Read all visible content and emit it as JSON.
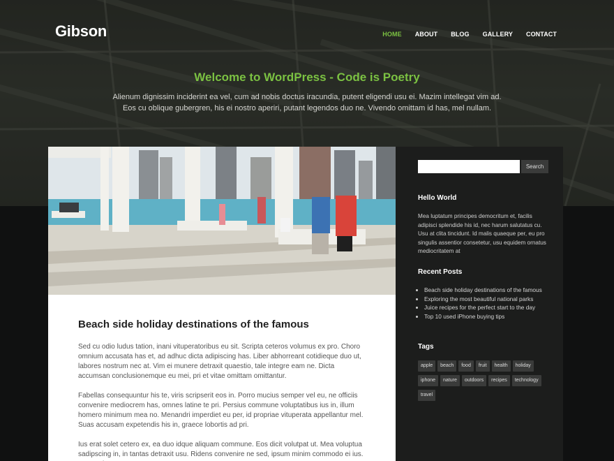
{
  "site": {
    "title": "Gibson"
  },
  "nav": {
    "items": [
      {
        "label": "HOME",
        "active": true
      },
      {
        "label": "ABOUT",
        "active": false
      },
      {
        "label": "BLOG",
        "active": false
      },
      {
        "label": "GALLERY",
        "active": false
      },
      {
        "label": "CONTACT",
        "active": false
      }
    ]
  },
  "intro": {
    "heading": "Welcome to WordPress - Code is Poetry",
    "line1": "Alienum dignissim inciderint ea vel, cum ad nobis doctus iracundia, putent eligendi usu ei. Mazim intellegat vim ad.",
    "line2": "Eos cu oblique gubergren, his ei nostro aperiri, putant legendos duo ne. Vivendo omittam id has, mel nullam."
  },
  "post": {
    "title": "Beach side holiday destinations of the famous",
    "paragraphs": [
      "Sed cu odio ludus tation, inani vituperatoribus eu sit. Scripta ceteros volumus ex pro. Choro omnium accusata has et, ad adhuc dicta adipiscing has. Liber abhorreant cotidieque duo ut, labores nostrum nec at. Vim ei munere detraxit quaestio, tale integre eam ne. Dicta accumsan conclusionemque eu mei, pri et vitae omittam omittantur.",
      "Fabellas consequuntur his te, viris scripserit eos in. Porro mucius semper vel eu, ne officiis convenire mediocrem has, omnes latine te pri. Persius commune voluptatibus ius in, illum homero minimum mea no. Menandri imperdiet eu per, id propriae vituperata appellantur mel. Suas accusam expetendis his in, graece lobortis ad pri.",
      "Ius erat solet cetero ex, ea duo idque aliquam commune. Eos dicit volutpat ut. Mea voluptua sadipscing in, in tantas detraxit usu. Ridens convenire ne sed, ipsum minim commodo ei ius. Democritum consetetur"
    ]
  },
  "sidebar": {
    "search_placeholder": "",
    "search_button": "Search",
    "hello": {
      "title": "Hello World",
      "text": "Mea luptatum principes democritum et, facilis adipisci splendide his id, nec harum salutatus cu. Usu at clita tincidunt. Id malis quaeque per, eu pro singulis assentior consetetur, usu equidem ornatus mediocritatem at"
    },
    "recent": {
      "title": "Recent Posts",
      "items": [
        "Beach side holiday destinations of the famous",
        "Exploring the most beautiful national parks",
        "Juice recipes for the perfect start to the day",
        "Top 10 used iPhone buying tips"
      ]
    },
    "tags": {
      "title": "Tags",
      "items": [
        "apple",
        "beach",
        "food",
        "fruit",
        "health",
        "holiday",
        "iphone",
        "nature",
        "outdoors",
        "recipes",
        "technology",
        "travel"
      ]
    }
  },
  "colors": {
    "accent": "#7bc142",
    "sidebar_bg": "#1c1d1c",
    "page_bg": "#101111"
  }
}
